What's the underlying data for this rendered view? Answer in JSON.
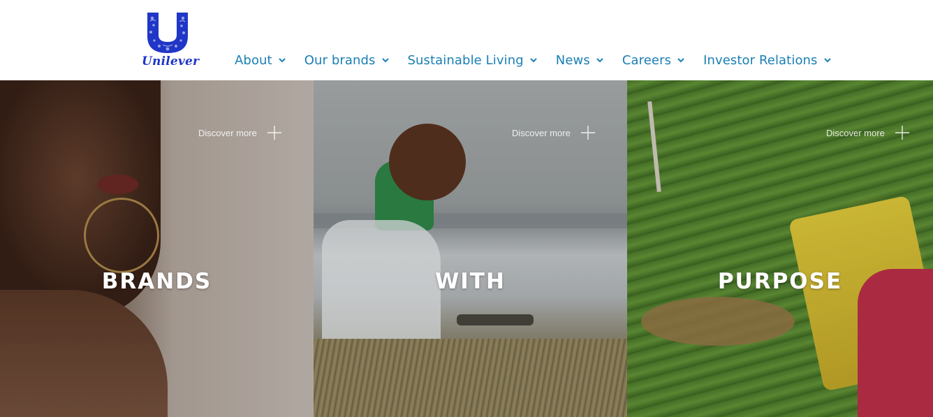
{
  "brand": {
    "logo_text": "Unilever",
    "logo_color": "#1f36c7"
  },
  "nav": {
    "items": [
      {
        "label": "About",
        "icon": "chevron-down-icon"
      },
      {
        "label": "Our brands",
        "icon": "chevron-down-icon"
      },
      {
        "label": "Sustainable Living",
        "icon": "chevron-down-icon"
      },
      {
        "label": "News",
        "icon": "chevron-down-icon"
      },
      {
        "label": "Careers",
        "icon": "chevron-down-icon"
      },
      {
        "label": "Investor Relations",
        "icon": "chevron-down-icon"
      }
    ],
    "color": "#1a7fb5"
  },
  "hero": {
    "panels": [
      {
        "title": "BRANDS",
        "cta": "Discover more",
        "icon": "plus-icon"
      },
      {
        "title": "WITH",
        "cta": "Discover more",
        "icon": "plus-icon"
      },
      {
        "title": "PURPOSE",
        "cta": "Discover more",
        "icon": "plus-icon"
      }
    ]
  }
}
